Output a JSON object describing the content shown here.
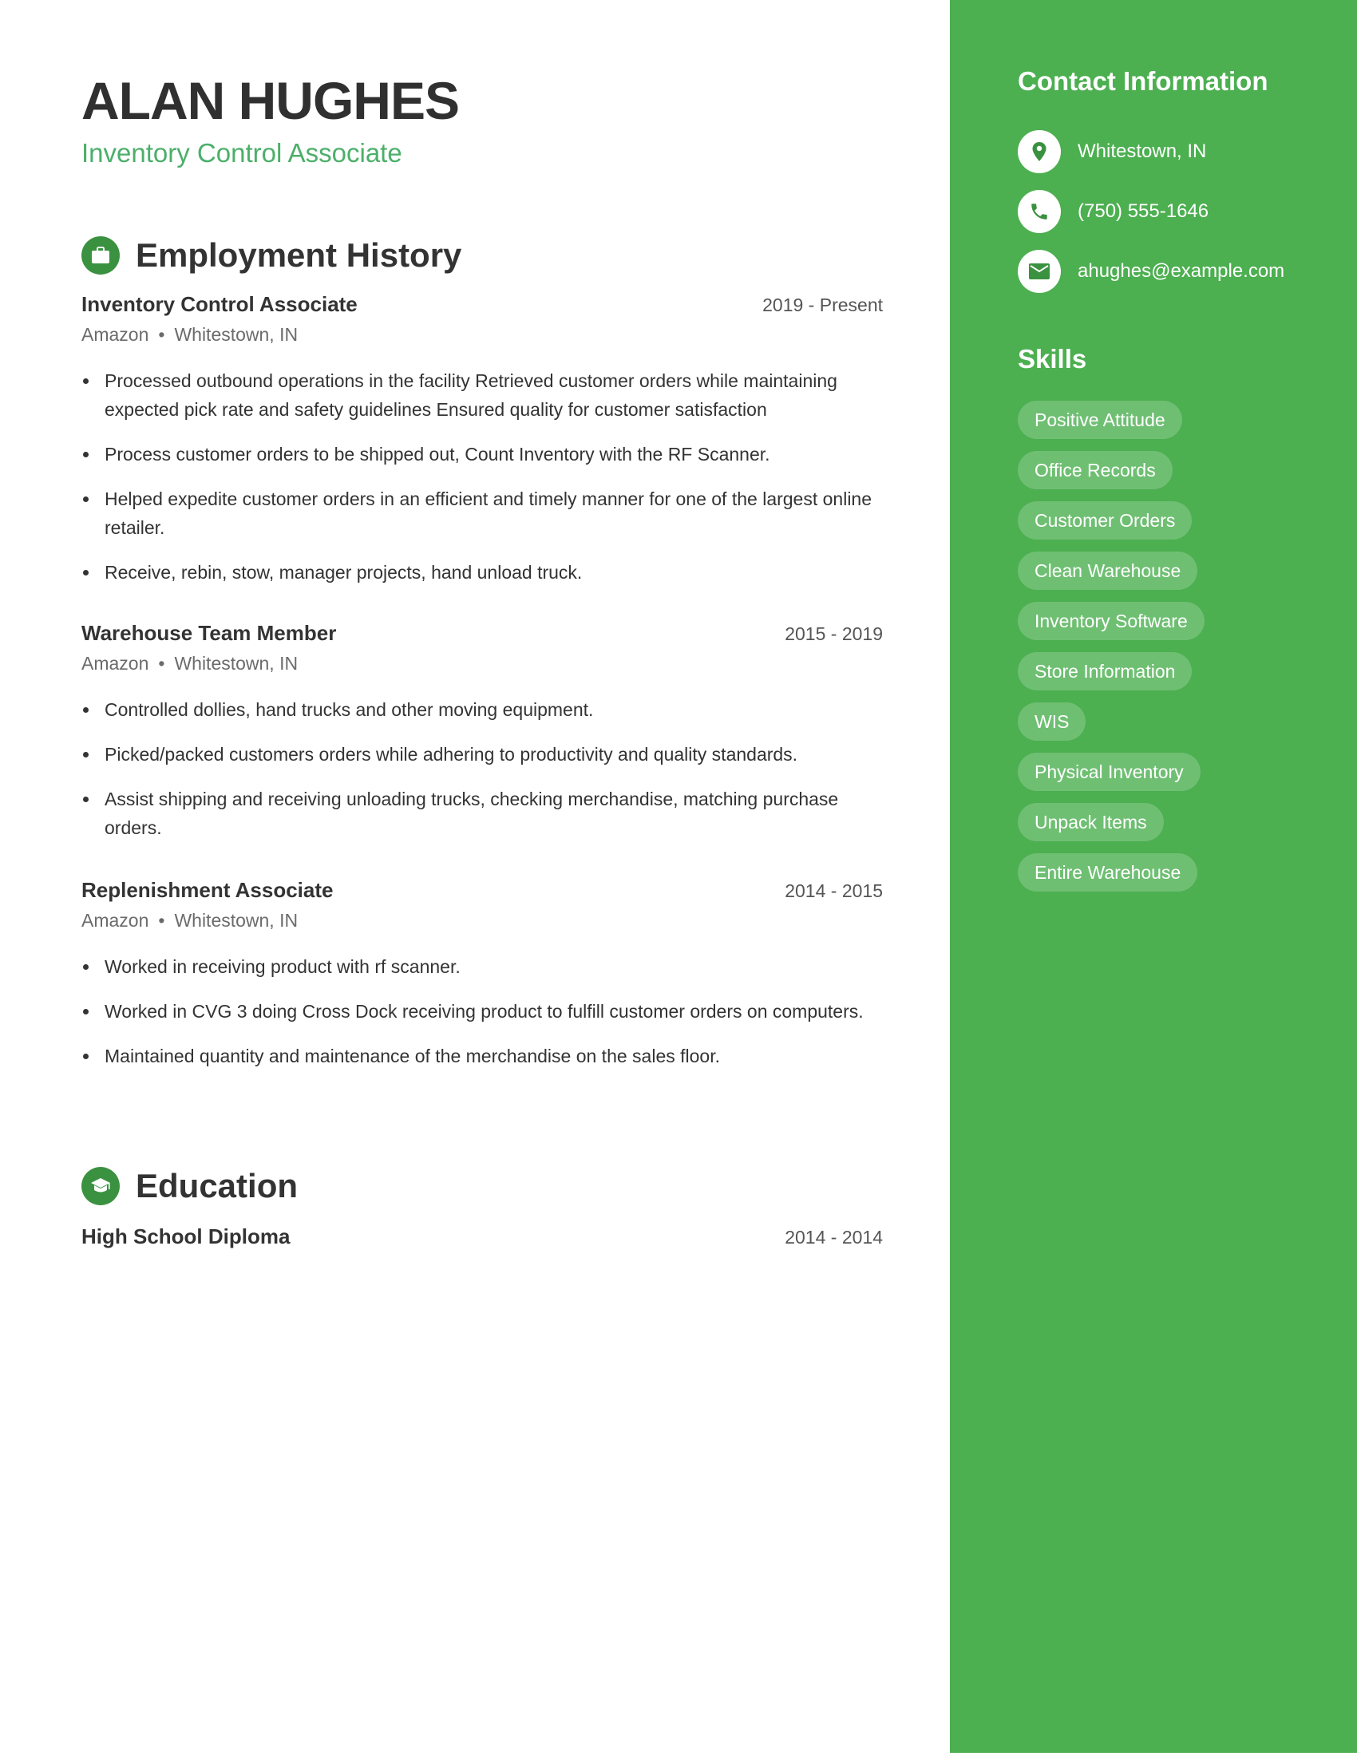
{
  "header": {
    "name": "ALAN HUGHES",
    "headline": "Inventory Control Associate"
  },
  "employment": {
    "title": "Employment History",
    "icon": "briefcase-icon",
    "jobs": [
      {
        "title": "Inventory Control Associate",
        "dates": "2019 - Present",
        "company": "Amazon",
        "separator": "•",
        "location": "Whitestown, IN",
        "bullets": [
          "Processed outbound operations in the facility Retrieved customer orders while maintaining expected pick rate and safety guidelines Ensured quality for customer satisfaction",
          "Process customer orders to be shipped out, Count Inventory with the RF Scanner.",
          "Helped expedite customer orders in an efficient and timely manner for one of the largest online retailer.",
          "Receive, rebin, stow, manager projects, hand unload truck."
        ]
      },
      {
        "title": "Warehouse Team Member",
        "dates": "2015 - 2019",
        "company": "Amazon",
        "separator": "•",
        "location": "Whitestown, IN",
        "bullets": [
          "Controlled dollies, hand trucks and other moving equipment.",
          "Picked/packed customers orders while adhering to productivity and quality standards.",
          "Assist shipping and receiving unloading trucks, checking merchandise, matching purchase orders."
        ]
      },
      {
        "title": "Replenishment Associate",
        "dates": "2014 - 2015",
        "company": "Amazon",
        "separator": "•",
        "location": "Whitestown, IN",
        "bullets": [
          "Worked in receiving product with rf scanner.",
          "Worked in CVG 3 doing Cross Dock receiving product to fulfill customer orders on computers.",
          "Maintained quantity and maintenance of the merchandise on the sales floor."
        ]
      }
    ]
  },
  "education": {
    "title": "Education",
    "icon": "graduation-cap-icon",
    "items": [
      {
        "title": "High School Diploma",
        "dates": "2014 - 2014"
      }
    ]
  },
  "sidebar": {
    "contact_title": "Contact Information",
    "contact": [
      {
        "icon": "location-pin-icon",
        "text": "Whitestown, IN"
      },
      {
        "icon": "phone-icon",
        "text": "(750) 555-1646"
      },
      {
        "icon": "email-icon",
        "text": "ahughes@example.com"
      }
    ],
    "skills_title": "Skills",
    "skills": [
      "Positive Attitude",
      "Office Records",
      "Customer Orders",
      "Clean Warehouse",
      "Inventory Software",
      "Store Information",
      "WIS",
      "Physical Inventory",
      "Unpack Items",
      "Entire Warehouse"
    ]
  },
  "colors": {
    "sidebar_green": "#4CAF50",
    "icon_green": "#3A9140",
    "headline_green": "#4CAF6A",
    "text_dark": "#333333"
  }
}
